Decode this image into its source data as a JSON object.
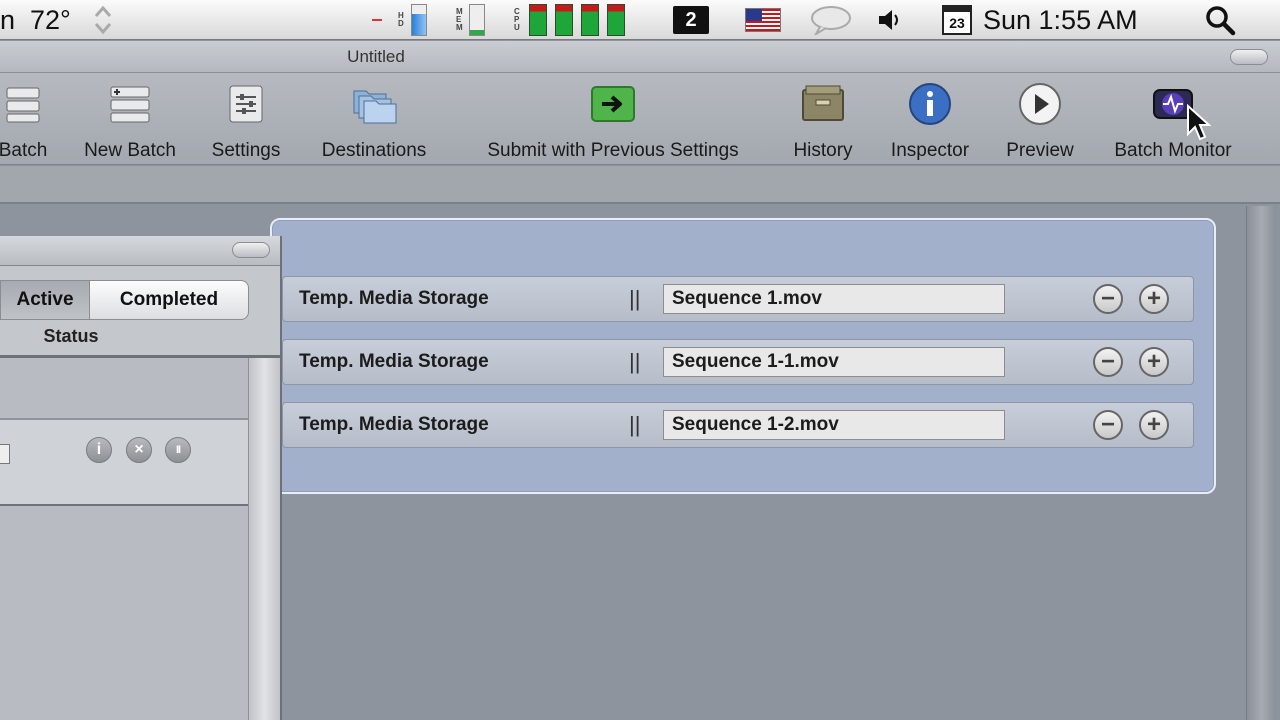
{
  "menubar": {
    "partial_left": "n",
    "temperature": "72°",
    "hd_label": "H D",
    "mem_label": "M E M",
    "cpu_label": "C P U",
    "space_number": "2",
    "calendar_day": "23",
    "clock": "Sun 1:55 AM"
  },
  "window": {
    "title": "Untitled"
  },
  "toolbar": {
    "items": [
      {
        "label": "Batch",
        "icon": "batch-icon"
      },
      {
        "label": "New Batch",
        "icon": "new-batch-icon"
      },
      {
        "label": "Settings",
        "icon": "settings-icon"
      },
      {
        "label": "Destinations",
        "icon": "destinations-icon"
      },
      {
        "label": "Submit with Previous Settings",
        "icon": "submit-arrow-icon"
      },
      {
        "label": "History",
        "icon": "history-drawer-icon"
      },
      {
        "label": "Inspector",
        "icon": "info-icon"
      },
      {
        "label": "Preview",
        "icon": "play-icon"
      },
      {
        "label": "Batch Monitor",
        "icon": "batch-monitor-icon"
      }
    ]
  },
  "batch": {
    "rows": [
      {
        "destination": "Temp. Media Storage",
        "separator": "||",
        "filename": "Sequence 1.mov"
      },
      {
        "destination": "Temp. Media Storage",
        "separator": "||",
        "filename": "Sequence 1-1.mov"
      },
      {
        "destination": "Temp. Media Storage",
        "separator": "||",
        "filename": "Sequence 1-2.mov"
      }
    ],
    "remove_symbol": "−",
    "add_symbol": "+"
  },
  "side_window": {
    "tabs": {
      "active": "Active",
      "completed": "Completed"
    },
    "status_label": "Status",
    "job_buttons": {
      "info": "i",
      "cancel": "×",
      "pause": "II"
    }
  },
  "colors": {
    "panel_blue": "#a3b0cc",
    "submit_green": "#2f9a2f",
    "inspector_blue": "#3b6fc4"
  }
}
